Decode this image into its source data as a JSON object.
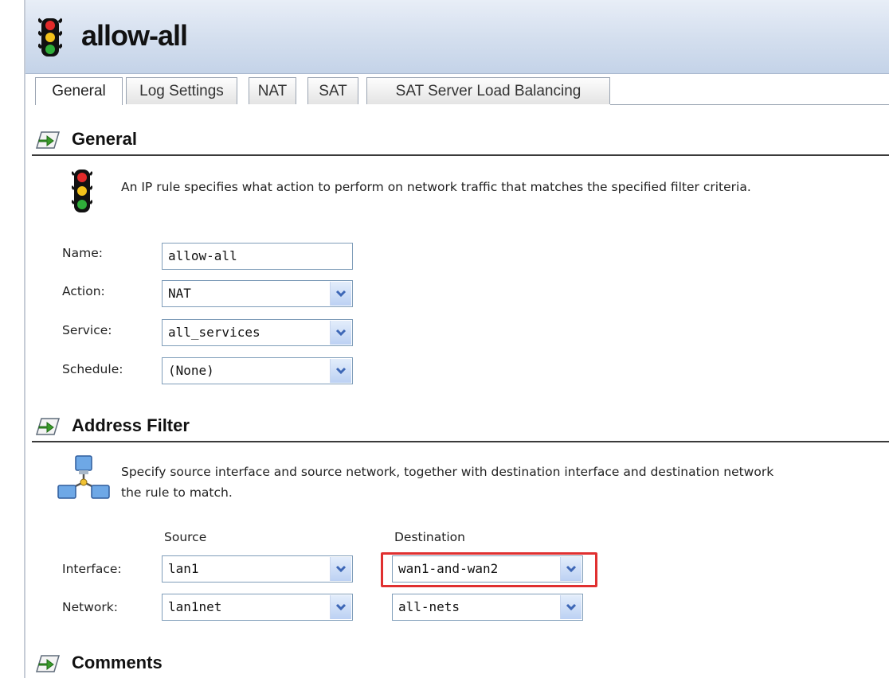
{
  "window": {
    "title": "allow-all"
  },
  "tabs": [
    {
      "label": "General"
    },
    {
      "label": "Log Settings"
    },
    {
      "label": "NAT"
    },
    {
      "label": "SAT"
    },
    {
      "label": "SAT Server Load Balancing"
    }
  ],
  "general": {
    "title": "General",
    "description": "An IP rule specifies what action to perform on network traffic that matches the specified filter criteria.",
    "name_label": "Name:",
    "name_value": "allow-all",
    "action_label": "Action:",
    "action_value": "NAT",
    "service_label": "Service:",
    "service_value": "all_services",
    "schedule_label": "Schedule:",
    "schedule_value": "(None)"
  },
  "address_filter": {
    "title": "Address Filter",
    "description_line1": "Specify source interface and source network, together with destination interface and destination network",
    "description_line2": "the rule to match.",
    "source_head": "Source",
    "destination_head": "Destination",
    "interface_label": "Interface:",
    "network_label": "Network:",
    "source_interface": "lan1",
    "source_network": "lan1net",
    "destination_interface": "wan1-and-wan2",
    "destination_network": "all-nets"
  },
  "comments": {
    "title": "Comments"
  },
  "colors": {
    "highlight": "#e03030",
    "header_band": "#d3deee"
  },
  "icons": {
    "title": "traffic-light-icon",
    "section": "arrow-right-icon",
    "address": "network-computers-icon",
    "dropdown": "chevron-down-icon"
  }
}
